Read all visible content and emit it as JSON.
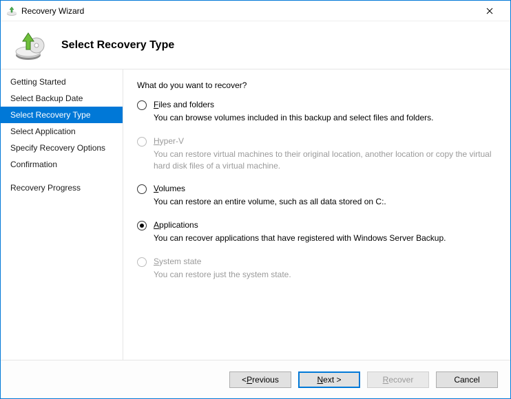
{
  "window": {
    "title": "Recovery Wizard"
  },
  "header": {
    "title": "Select Recovery Type"
  },
  "sidebar": {
    "items": [
      {
        "label": "Getting Started"
      },
      {
        "label": "Select Backup Date"
      },
      {
        "label": "Select Recovery Type"
      },
      {
        "label": "Select Application"
      },
      {
        "label": "Specify Recovery Options"
      },
      {
        "label": "Confirmation"
      },
      {
        "label": "Recovery Progress"
      }
    ],
    "selectedIndex": 2
  },
  "content": {
    "prompt": "What do you want to recover?",
    "options": [
      {
        "key": "files",
        "accel": "F",
        "rest": "iles and folders",
        "desc": "You can browse volumes included in this backup and select files and folders.",
        "enabled": true,
        "selected": false
      },
      {
        "key": "hyperv",
        "accel": "H",
        "rest": "yper-V",
        "desc": "You can restore virtual machines to their original location, another location or copy the virtual hard disk files of a virtual machine.",
        "enabled": false,
        "selected": false
      },
      {
        "key": "volumes",
        "accel": "V",
        "rest": "olumes",
        "desc": "You can restore an entire volume, such as all data stored on C:.",
        "enabled": true,
        "selected": false
      },
      {
        "key": "applications",
        "accel": "A",
        "rest": "pplications",
        "desc": "You can recover applications that have registered with Windows Server Backup.",
        "enabled": true,
        "selected": true
      },
      {
        "key": "systemstate",
        "accel": "S",
        "rest": "ystem state",
        "desc": "You can restore just the system state.",
        "enabled": false,
        "selected": false
      }
    ]
  },
  "footer": {
    "previous_prefix": "< ",
    "previous_accel": "P",
    "previous_rest": "revious",
    "next_accel": "N",
    "next_rest": "ext >",
    "recover_accel": "R",
    "recover_rest": "ecover",
    "cancel": "Cancel"
  }
}
